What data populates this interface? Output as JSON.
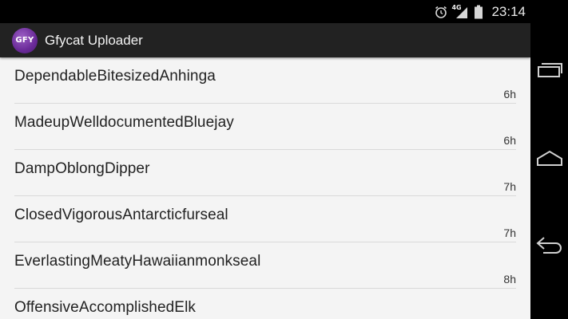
{
  "status_bar": {
    "time": "23:14",
    "network_label": "4G",
    "icons": [
      "alarm-icon",
      "signal-icon",
      "battery-icon"
    ]
  },
  "app": {
    "logo_text": "GFY",
    "title": "Gfycat Uploader",
    "accent_color": "#6a2a98"
  },
  "items": [
    {
      "name": "DependableBitesizedAnhinga",
      "age": "6h"
    },
    {
      "name": "MadeupWelldocumentedBluejay",
      "age": "6h"
    },
    {
      "name": "DampOblongDipper",
      "age": "7h"
    },
    {
      "name": "ClosedVigorousAntarcticfurseal",
      "age": "7h"
    },
    {
      "name": "EverlastingMeatyHawaiianmonkseal",
      "age": "8h"
    },
    {
      "name": "OffensiveAccomplishedElk",
      "age": ""
    }
  ],
  "nav": [
    "recent-apps-icon",
    "home-icon",
    "back-icon"
  ]
}
